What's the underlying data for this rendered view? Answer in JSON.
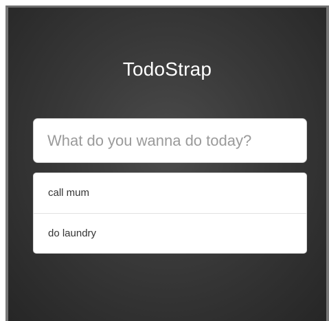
{
  "app": {
    "title": "TodoStrap"
  },
  "new_todo": {
    "value": "",
    "placeholder": "What do you wanna do today?"
  },
  "todos": [
    {
      "label": "call mum"
    },
    {
      "label": "do laundry"
    }
  ],
  "colors": {
    "background_center": "#4b4b4b",
    "background_edge": "#262626",
    "frame_border": "#777777",
    "title_text": "#ffffff",
    "placeholder_text": "#9a9a9a",
    "item_text": "#333333"
  }
}
